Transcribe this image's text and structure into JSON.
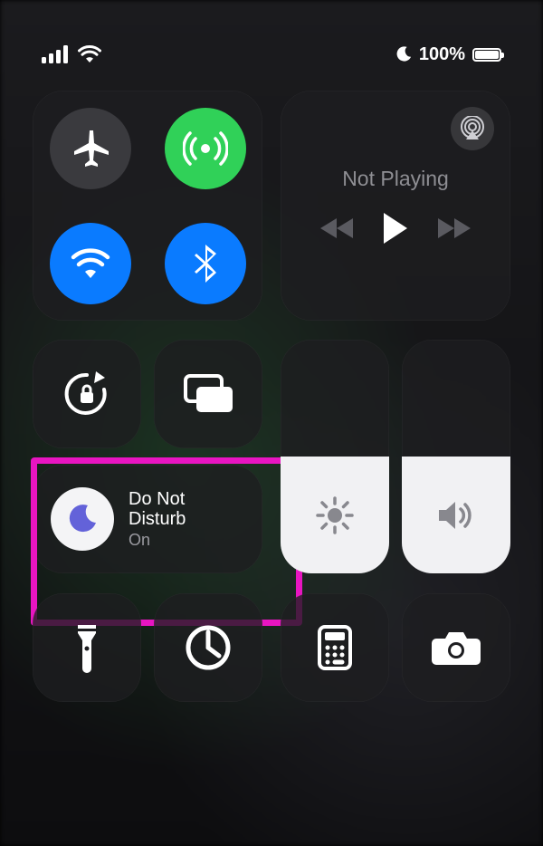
{
  "status": {
    "battery_text": "100%"
  },
  "media": {
    "title": "Not Playing"
  },
  "dnd": {
    "title": "Do Not\nDisturb",
    "status": "On"
  },
  "icons": {
    "airplane": "airplane-icon",
    "cellular": "cellular-antenna-icon",
    "wifi": "wifi-icon",
    "bluetooth": "bluetooth-icon",
    "airplay": "airplay-icon",
    "rewind": "rewind-icon",
    "play": "play-icon",
    "forward": "forward-icon",
    "orientation_lock": "orientation-lock-icon",
    "mirroring": "screen-mirroring-icon",
    "dnd": "moon-icon",
    "brightness": "brightness-icon",
    "volume": "speaker-icon",
    "flashlight": "flashlight-icon",
    "timer": "timer-icon",
    "calculator": "calculator-icon",
    "camera": "camera-icon",
    "signal": "signal-bars-icon",
    "wifi_status": "wifi-status-icon",
    "dnd_status": "moon-status-icon",
    "battery": "battery-icon"
  }
}
